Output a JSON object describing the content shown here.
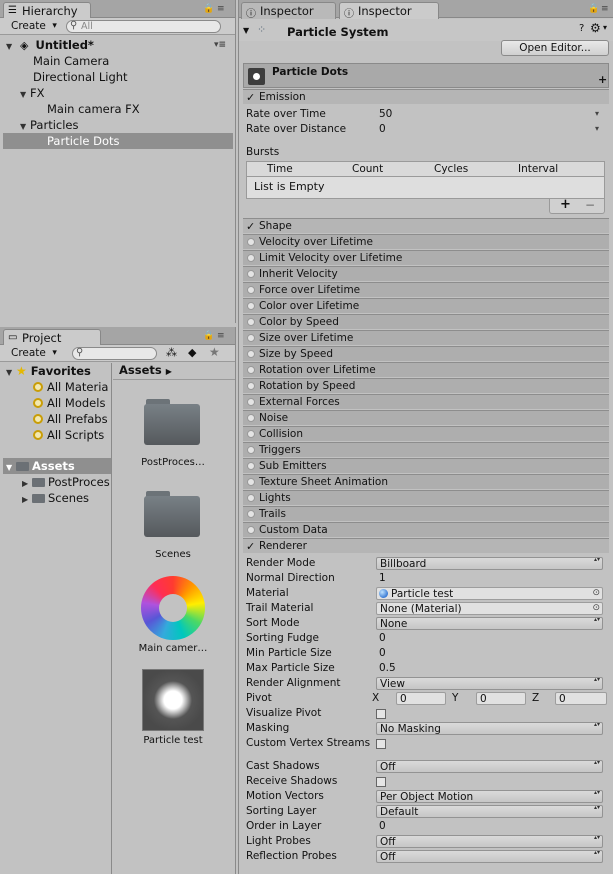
{
  "hierarchy": {
    "tab_label": "Hierarchy",
    "create_label": "Create",
    "search_placeholder": "All",
    "scene_name": "Untitled*",
    "items": [
      {
        "label": "Main Camera"
      },
      {
        "label": "Directional Light"
      },
      {
        "label": "FX"
      },
      {
        "label": "Main camera FX"
      },
      {
        "label": "Particles"
      },
      {
        "label": "Particle Dots"
      }
    ]
  },
  "project": {
    "tab_label": "Project",
    "create_label": "Create",
    "favorites_label": "Favorites",
    "favorites": [
      {
        "label": "All Materia"
      },
      {
        "label": "All Models"
      },
      {
        "label": "All Prefabs"
      },
      {
        "label": "All Scripts"
      }
    ],
    "assets_label": "Assets",
    "asset_folders": [
      {
        "label": "PostProces"
      },
      {
        "label": "Scenes"
      }
    ],
    "breadcrumb": "Assets",
    "assets": [
      {
        "label": "PostProces…"
      },
      {
        "label": "Scenes"
      },
      {
        "label": "Main camer…"
      },
      {
        "label": "Particle test"
      }
    ]
  },
  "inspector": {
    "tab1": "Inspector",
    "tab2": "Inspector",
    "component_title": "Particle System",
    "open_editor": "Open Editor...",
    "system_name": "Particle Dots",
    "emission": {
      "title": "Emission",
      "rate_over_time_label": "Rate over Time",
      "rate_over_time": "50",
      "rate_over_distance_label": "Rate over Distance",
      "rate_over_distance": "0",
      "bursts_label": "Bursts",
      "bursts_columns": [
        "Time",
        "Count",
        "Cycles",
        "Interval"
      ],
      "bursts_empty": "List is Empty",
      "add": "+",
      "remove": "−"
    },
    "modules": [
      {
        "label": "Shape",
        "enabled": true
      },
      {
        "label": "Velocity over Lifetime",
        "enabled": false
      },
      {
        "label": "Limit Velocity over Lifetime",
        "enabled": false
      },
      {
        "label": "Inherit Velocity",
        "enabled": false
      },
      {
        "label": "Force over Lifetime",
        "enabled": false
      },
      {
        "label": "Color over Lifetime",
        "enabled": false
      },
      {
        "label": "Color by Speed",
        "enabled": false
      },
      {
        "label": "Size over Lifetime",
        "enabled": false
      },
      {
        "label": "Size by Speed",
        "enabled": false
      },
      {
        "label": "Rotation over Lifetime",
        "enabled": false
      },
      {
        "label": "Rotation by Speed",
        "enabled": false
      },
      {
        "label": "External Forces",
        "enabled": false
      },
      {
        "label": "Noise",
        "enabled": false
      },
      {
        "label": "Collision",
        "enabled": false
      },
      {
        "label": "Triggers",
        "enabled": false
      },
      {
        "label": "Sub Emitters",
        "enabled": false
      },
      {
        "label": "Texture Sheet Animation",
        "enabled": false
      },
      {
        "label": "Lights",
        "enabled": false
      },
      {
        "label": "Trails",
        "enabled": false
      },
      {
        "label": "Custom Data",
        "enabled": false
      },
      {
        "label": "Renderer",
        "enabled": true
      }
    ],
    "renderer": {
      "render_mode_label": "Render Mode",
      "render_mode": "Billboard",
      "normal_direction_label": "Normal Direction",
      "normal_direction": "1",
      "material_label": "Material",
      "material": "Particle test",
      "trail_material_label": "Trail Material",
      "trail_material": "None (Material)",
      "sort_mode_label": "Sort Mode",
      "sort_mode": "None",
      "sorting_fudge_label": "Sorting Fudge",
      "sorting_fudge": "0",
      "min_particle_size_label": "Min Particle Size",
      "min_particle_size": "0",
      "max_particle_size_label": "Max Particle Size",
      "max_particle_size": "0.5",
      "render_alignment_label": "Render Alignment",
      "render_alignment": "View",
      "pivot_label": "Pivot",
      "pivot_x_label": "X",
      "pivot_x": "0",
      "pivot_y_label": "Y",
      "pivot_y": "0",
      "pivot_z_label": "Z",
      "pivot_z": "0",
      "visualize_pivot_label": "Visualize Pivot",
      "masking_label": "Masking",
      "masking": "No Masking",
      "custom_vertex_streams_label": "Custom Vertex Streams",
      "cast_shadows_label": "Cast Shadows",
      "cast_shadows": "Off",
      "receive_shadows_label": "Receive Shadows",
      "motion_vectors_label": "Motion Vectors",
      "motion_vectors": "Per Object Motion",
      "sorting_layer_label": "Sorting Layer",
      "sorting_layer": "Default",
      "order_in_layer_label": "Order in Layer",
      "order_in_layer": "0",
      "light_probes_label": "Light Probes",
      "light_probes": "Off",
      "reflection_probes_label": "Reflection Probes",
      "reflection_probes": "Off"
    }
  }
}
